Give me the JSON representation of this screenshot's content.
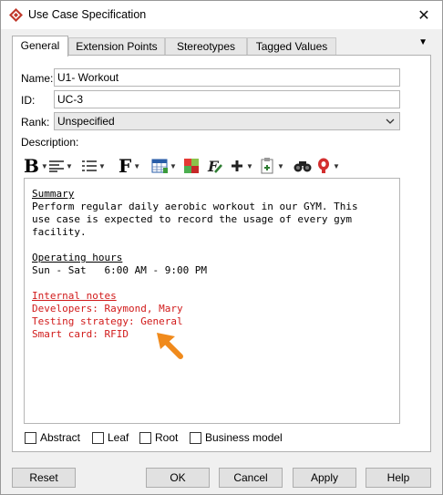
{
  "window": {
    "title": "Use Case Specification"
  },
  "tabs": [
    "General",
    "Extension Points",
    "Stereotypes",
    "Tagged Values"
  ],
  "tab_overflow_icon": "triangle-down-icon",
  "form": {
    "name_label": "Name:",
    "name_value": "U1- Workout",
    "id_label": "ID:",
    "id_value": "UC-3",
    "rank_label": "Rank:",
    "rank_value": "Unspecified",
    "description_label": "Description:"
  },
  "toolbar": {
    "bold": "B",
    "font": "F",
    "icons": [
      "bold-icon",
      "align-icon",
      "list-icon",
      "font-icon",
      "table-icon",
      "image-icon",
      "format-icon",
      "insert-icon",
      "paste-icon",
      "find-icon",
      "spellcheck-icon"
    ]
  },
  "description": {
    "summary_heading": "Summary",
    "summary_lines": [
      "Perform regular daily aerobic workout in our GYM. This",
      "use case is expected to record the usage of every gym",
      "facility."
    ],
    "hours_heading": "Operating hours",
    "hours_line": "Sun - Sat   6:00 AM - 9:00 PM",
    "notes_heading": "Internal notes",
    "notes_lines": [
      "Developers: Raymond, Mary",
      "Testing strategy: General",
      "Smart card: RFID"
    ],
    "notes_color": "#d11a1a"
  },
  "annotation_arrow_color": "#f08a1c",
  "checkboxes": [
    {
      "label": "Abstract",
      "checked": false
    },
    {
      "label": "Leaf",
      "checked": false
    },
    {
      "label": "Root",
      "checked": false
    },
    {
      "label": "Business model",
      "checked": false
    }
  ],
  "buttons": {
    "reset": "Reset",
    "ok": "OK",
    "cancel": "Cancel",
    "apply": "Apply",
    "help": "Help"
  }
}
